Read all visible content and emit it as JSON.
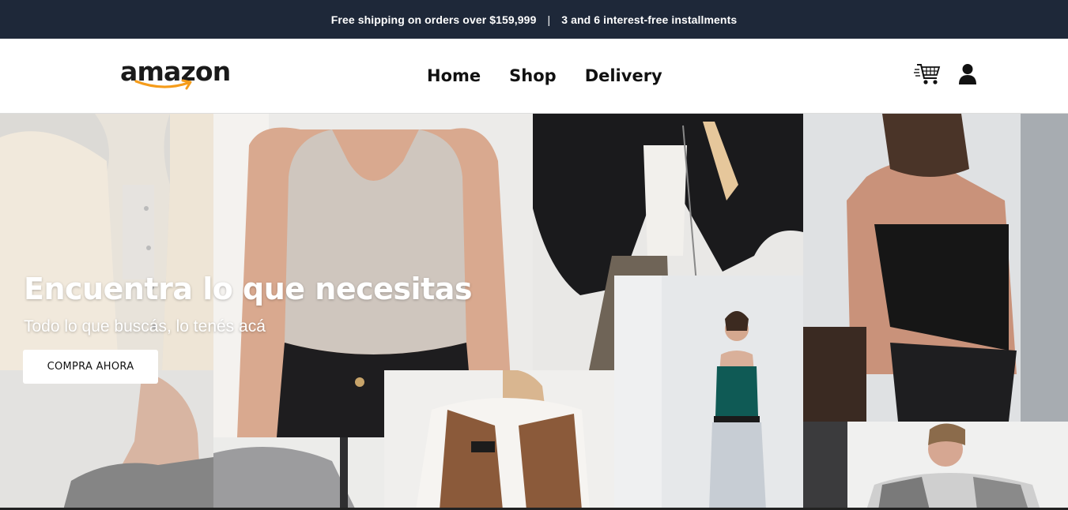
{
  "announcement": {
    "shipping": "Free shipping on orders over $159,999",
    "separator": "|",
    "installments": "3 and 6 interest-free installments"
  },
  "brand": {
    "name": "amazon",
    "accent_color": "#f59c1a"
  },
  "nav": {
    "home": "Home",
    "shop": "Shop",
    "delivery": "Delivery"
  },
  "icons": {
    "cart": "shopping-cart-icon",
    "account": "user-icon"
  },
  "hero": {
    "title": "Encuentra lo que necesitas",
    "subtitle": "Todo lo que buscás, lo tenés acá",
    "cta": "COMPRA AHORA"
  },
  "colors": {
    "topbar": "#1e2839",
    "text": "#111111"
  }
}
